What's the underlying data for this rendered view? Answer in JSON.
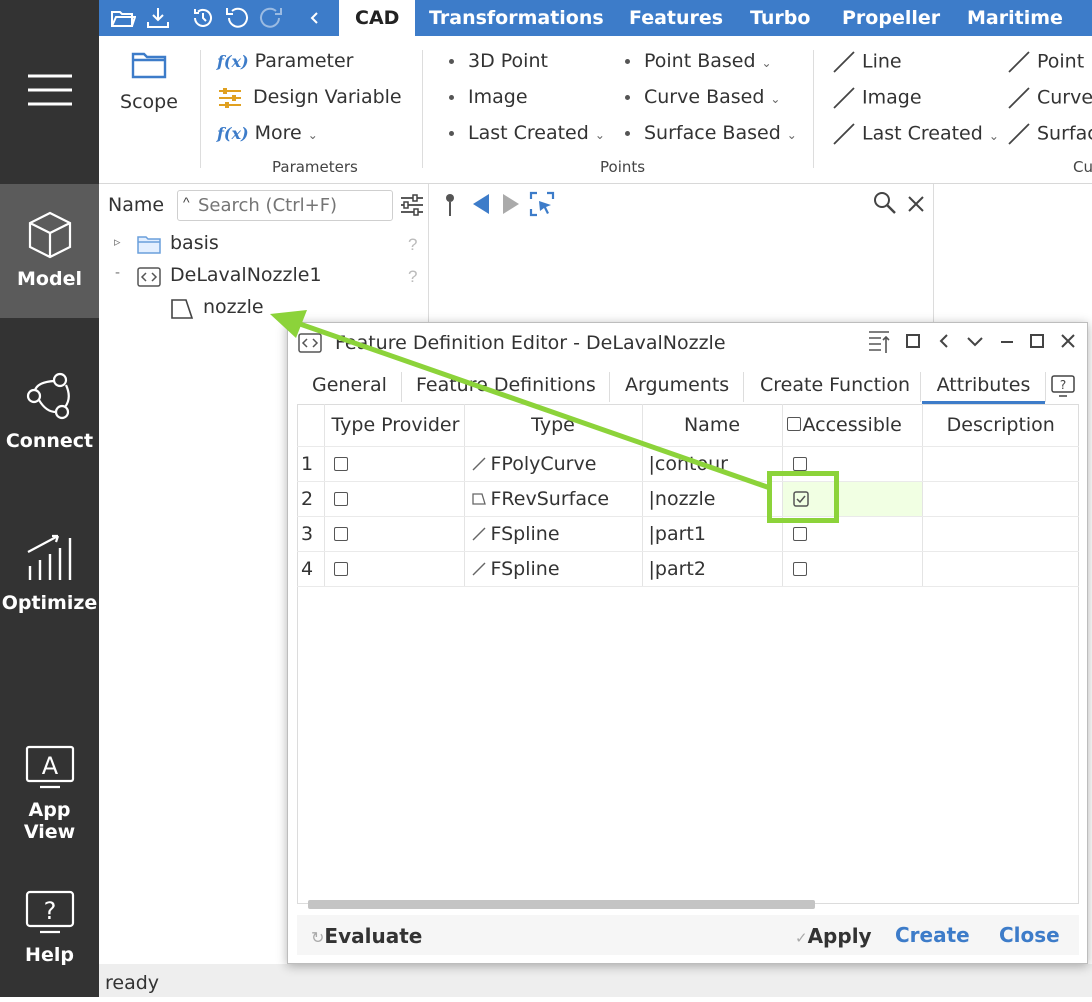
{
  "nav": {
    "items": [
      {
        "label": "Model",
        "icon": "cube-icon"
      },
      {
        "label": "Connect",
        "icon": "connect-icon"
      },
      {
        "label": "Optimize",
        "icon": "optimize-icon"
      },
      {
        "label": "App View",
        "icon": "app-view-icon"
      },
      {
        "label": "Help",
        "icon": "help-icon"
      }
    ]
  },
  "tabs": [
    "CAD",
    "Transformations",
    "Features",
    "Turbo",
    "Propeller",
    "Maritime"
  ],
  "ribbon": {
    "scope": "Scope",
    "params": {
      "parameter": "Parameter",
      "design_variable": "Design Variable",
      "more": "More",
      "group": "Parameters",
      "fx": "f(x)"
    },
    "points": {
      "col1": [
        "3D Point",
        "Image",
        "Last Created"
      ],
      "col2": [
        "Point Based",
        "Curve Based",
        "Surface Based"
      ],
      "group": "Points"
    },
    "curves": {
      "col1": [
        "Line",
        "Image",
        "Last Created"
      ],
      "col2": [
        "Point",
        "Curve",
        "Surfac"
      ],
      "group": "Cu"
    }
  },
  "tree": {
    "header": "Name",
    "search_placeholder": "Search (Ctrl+F)",
    "items": [
      {
        "label": "basis",
        "toggle": "▹",
        "mark": "?"
      },
      {
        "label": "DeLavalNozzle1",
        "toggle": "-",
        "mark": "?"
      },
      {
        "label": "nozzle"
      }
    ]
  },
  "dialog": {
    "title": "Feature Definition Editor - DeLavalNozzle",
    "tabs": [
      "General",
      "Feature Definitions",
      "Arguments",
      "Create Function",
      "Attributes"
    ],
    "active_tab": "Attributes",
    "columns": [
      "Type Provider",
      "Type",
      "Name",
      "Accessible",
      "Description"
    ],
    "rows": [
      {
        "num": "1",
        "type": "FPolyCurve",
        "name": "contour",
        "accessible": false
      },
      {
        "num": "2",
        "type": "FRevSurface",
        "name": "nozzle",
        "accessible": true
      },
      {
        "num": "3",
        "type": "FSpline",
        "name": "part1",
        "accessible": false
      },
      {
        "num": "4",
        "type": "FSpline",
        "name": "part2",
        "accessible": false
      }
    ],
    "buttons": {
      "evaluate": "Evaluate",
      "apply": "Apply",
      "create": "Create",
      "close": "Close"
    }
  },
  "status": "ready",
  "colors": {
    "accent": "#3d7cc9",
    "nav_bg": "#333333",
    "highlight": "#8cd33a"
  }
}
